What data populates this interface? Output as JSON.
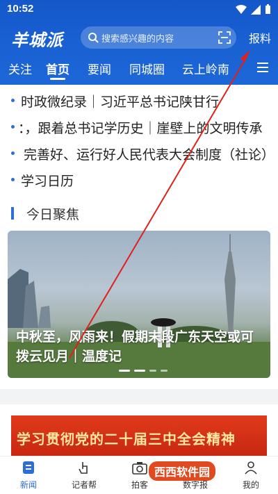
{
  "status": {
    "time": "10:52"
  },
  "header": {
    "logo": "羊城派",
    "search_placeholder": "搜索感兴趣的内容",
    "report_label": "报料"
  },
  "tabs": [
    {
      "label": "关注"
    },
    {
      "label": "首页",
      "active": true
    },
    {
      "label": "要闻"
    },
    {
      "label": "同城圈"
    },
    {
      "label": "云上岭南"
    }
  ],
  "headlines": [
    {
      "text": "时政微纪录｜习近平总书记陕甘行"
    },
    {
      "text": "：，跟着总书记学历史｜崖壁上的文明传承"
    },
    {
      "text": "完善好、运行好人民代表大会制度（社论）"
    },
    {
      "text": "学习日历"
    }
  ],
  "section": {
    "title": "今日聚焦"
  },
  "hero": {
    "caption": "中秋至，风雨来！假期末段广东天空或可拨云见月｜温度记"
  },
  "banner": {
    "text": "学习贯彻党的二十届三中全会精神"
  },
  "bottom_nav": [
    {
      "label": "新闻",
      "icon": "news-icon",
      "active": true
    },
    {
      "label": "记者帮",
      "icon": "hand-pointer-icon"
    },
    {
      "label": "拍客",
      "icon": "camera-icon"
    },
    {
      "label": "数字报",
      "icon": "newspaper-icon"
    },
    {
      "label": "我的",
      "icon": "user-icon"
    }
  ],
  "watermark": {
    "text": "西西软件园"
  },
  "colors": {
    "brand_blue": "#1a62d4",
    "accent": "#2b6fd6",
    "banner_red": "#d5301a",
    "arrow_red": "#e0201a"
  }
}
